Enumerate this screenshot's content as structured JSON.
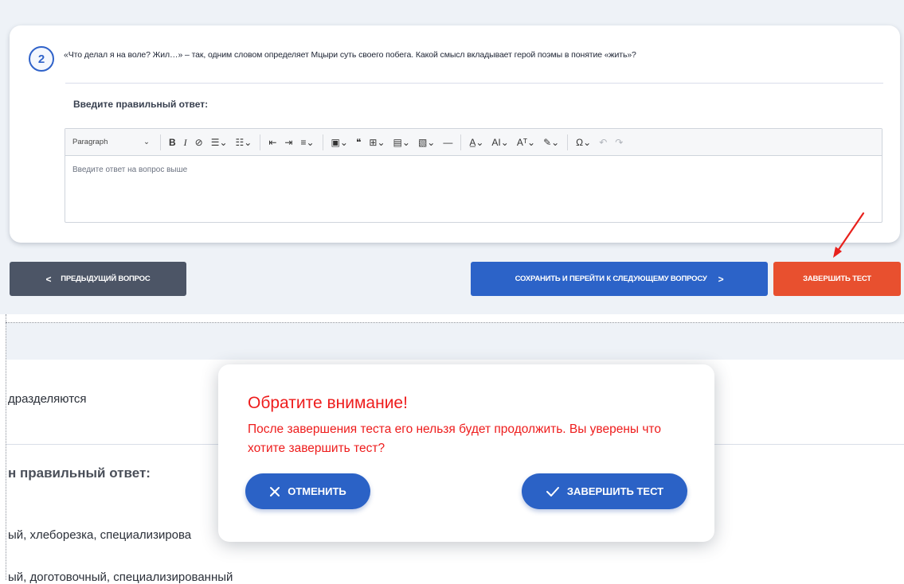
{
  "question": {
    "number": "2",
    "text": "«Что делал я на воле? Жил…» – так, одним словом определяет Мцыри суть своего побега. Какой смысл вкладывает герой поэмы в понятие «жить»?",
    "answer_label": "Введите правильный ответ:"
  },
  "editor": {
    "paragraph_label": "Paragraph",
    "placeholder": "Введите ответ на вопрос выше"
  },
  "nav": {
    "prev_label": "ПРЕДЫДУЩИЙ ВОПРОС",
    "next_label": "СОХРАНИТЬ И ПЕРЕЙТИ К СЛЕДУЮЩЕМУ ВОПРОСУ",
    "finish_label": "ЗАВЕРШИТЬ ТЕСТ"
  },
  "background": {
    "text1": "дразделяются",
    "label": "н правильный ответ:",
    "option1": "ый, хлеборезка, специализирова",
    "option2": "ый, доготовочный, специализированный"
  },
  "modal": {
    "title": "Обратите внимание!",
    "message": "После завершения теста его нельзя будет продолжить. Вы уверены что хотите завершить тест?",
    "cancel_label": "ОТМЕНИТЬ",
    "confirm_label": "ЗАВЕРШИТЬ ТЕСТ"
  },
  "colors": {
    "primary": "#2c63c8",
    "danger": "#e8502f",
    "warning_text": "#ee1c1c",
    "secondary": "#4c5566"
  }
}
